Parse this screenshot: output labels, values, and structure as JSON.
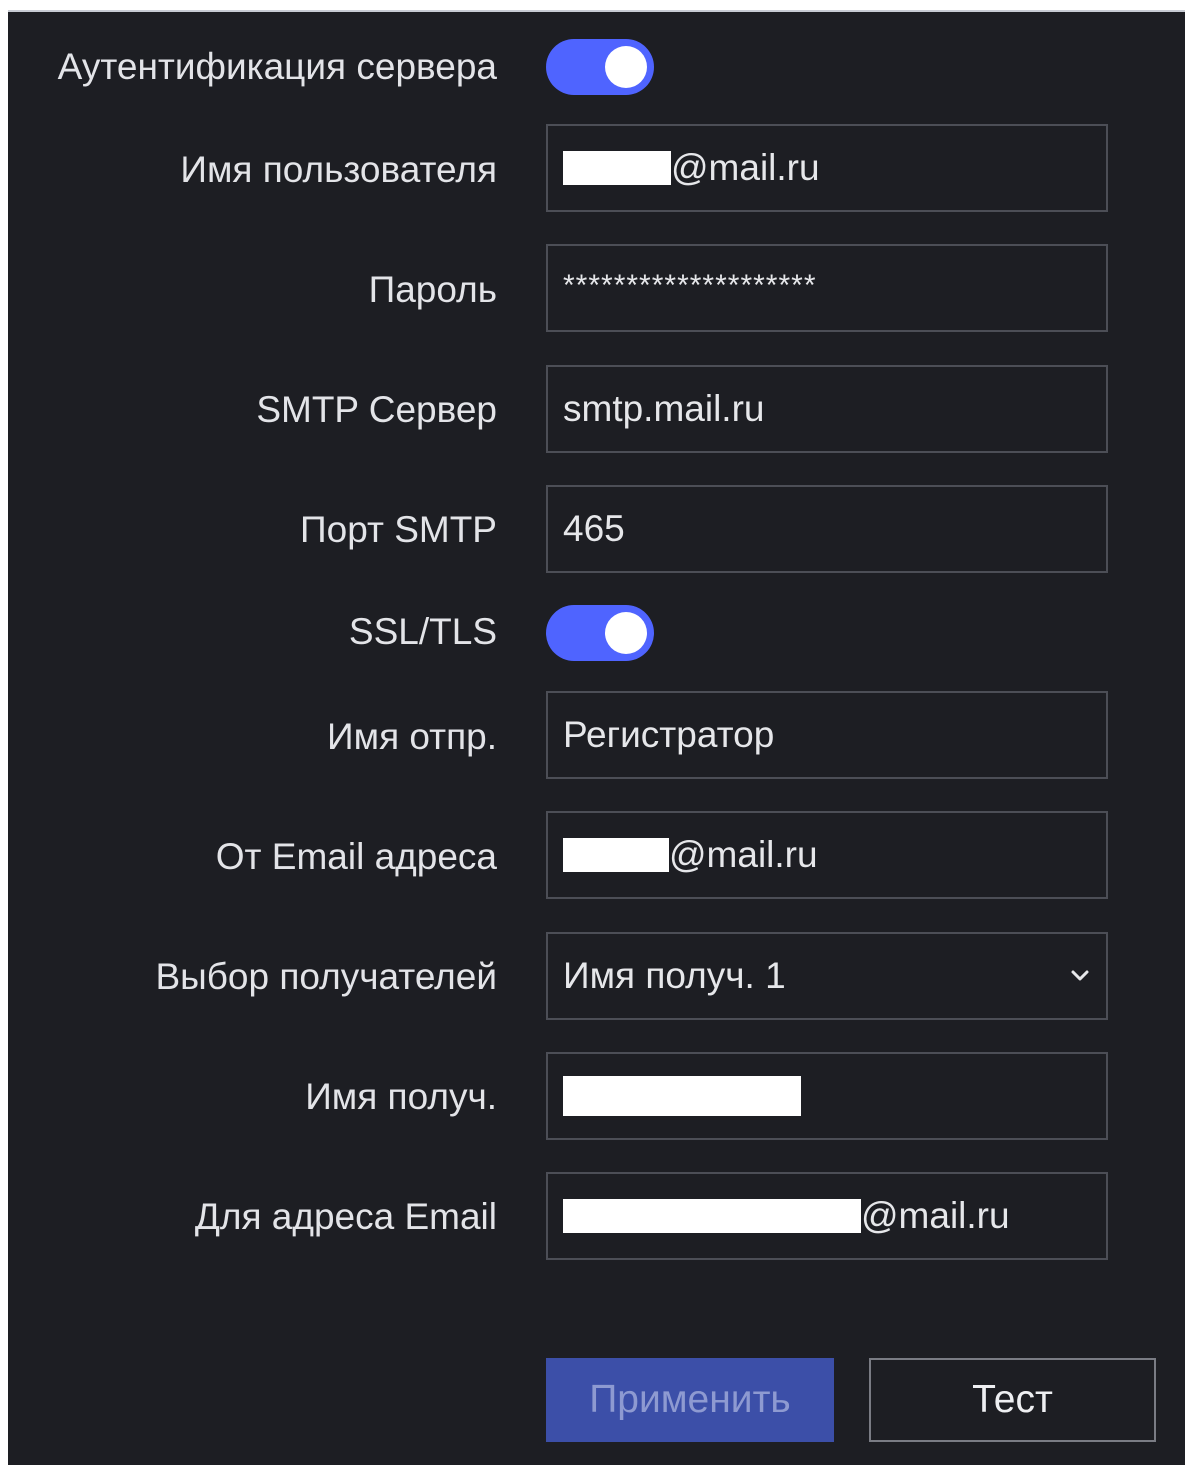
{
  "form": {
    "server_auth": {
      "label": "Аутентификация сервера",
      "enabled": true
    },
    "username": {
      "label": "Имя пользователя",
      "value_suffix": "@mail.ru"
    },
    "password": {
      "label": "Пароль",
      "value": "********************"
    },
    "smtp_server": {
      "label": "SMTP Сервер",
      "value": "smtp.mail.ru"
    },
    "smtp_port": {
      "label": "Порт SMTP",
      "value": "465"
    },
    "ssl_tls": {
      "label": "SSL/TLS",
      "enabled": true
    },
    "sender_name": {
      "label": "Имя отпр.",
      "value": "Регистратор"
    },
    "from_email": {
      "label": "От Email адреса",
      "value_suffix": "@mail.ru"
    },
    "recipient_select": {
      "label": "Выбор получателей",
      "value": "Имя получ. 1"
    },
    "recipient_name": {
      "label": "Имя получ."
    },
    "to_email": {
      "label": "Для адреса Email",
      "value_suffix": "@mail.ru"
    }
  },
  "buttons": {
    "apply": "Применить",
    "test": "Тест"
  },
  "colors": {
    "background": "#1d1e23",
    "accent": "#4f64ff",
    "apply_button": "#3c4fa8"
  }
}
